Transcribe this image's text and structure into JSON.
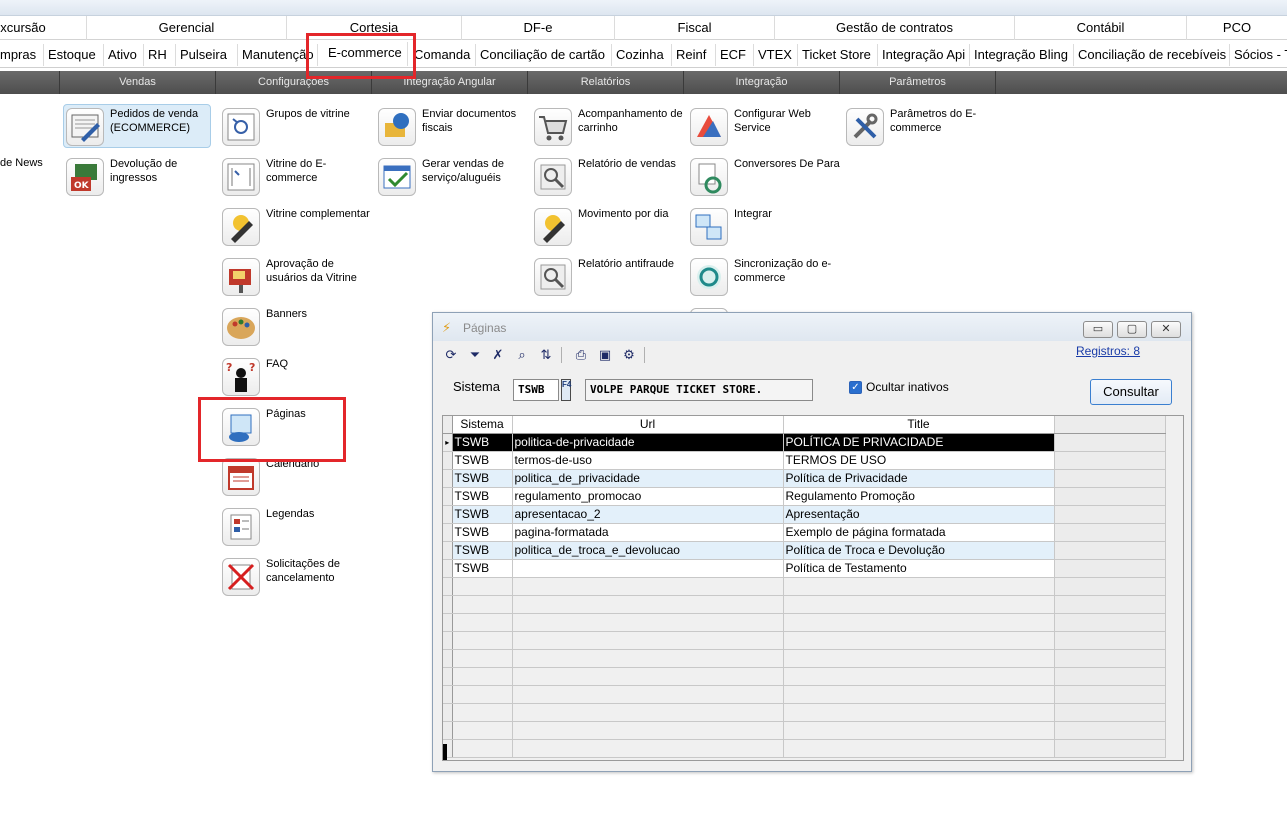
{
  "menu_top": [
    "xcursão",
    "Gerencial",
    "Cortesia",
    "DF-e",
    "Fiscal",
    "Gestão de contratos",
    "Contábil",
    "PCO"
  ],
  "menu_tabs": [
    "mpras",
    "Estoque",
    "Ativo",
    "RH",
    "Pulseira",
    "Manutenção",
    "E-commerce",
    "Comanda",
    "Conciliação de cartão",
    "Cozinha",
    "Reinf",
    "ECF",
    "VTEX",
    "Ticket Store",
    "Integração Api",
    "Integração Bling",
    "Conciliação de recebíveis",
    "Sócios - T"
  ],
  "active_tab": "E-commerce",
  "sections": [
    "Vendas",
    "Configurações",
    "Integração Angular",
    "Relatórios",
    "Integração",
    "Parâmetros"
  ],
  "col0": {
    "news_label": "de News"
  },
  "col_vendas": [
    {
      "label": "Pedidos de venda (ECOMMERCE)",
      "icon": "sales-order-icon"
    },
    {
      "label": "Devolução de ingressos",
      "icon": "ticket-return-icon"
    }
  ],
  "col_config": [
    {
      "label": "Grupos de vitrine",
      "icon": "showcase-group-icon"
    },
    {
      "label": "Vitrine do E-commerce",
      "icon": "showcase-icon"
    },
    {
      "label": "Vitrine complementar",
      "icon": "complementary-showcase-icon"
    },
    {
      "label": "Aprovação de usuários da Vitrine",
      "icon": "mailbox-icon"
    },
    {
      "label": "Banners",
      "icon": "palette-icon"
    },
    {
      "label": "FAQ",
      "icon": "question-person-icon"
    },
    {
      "label": "Páginas",
      "icon": "pages-computer-icon"
    },
    {
      "label": "Calendário",
      "icon": "calendar-icon"
    },
    {
      "label": "Legendas",
      "icon": "legend-icon"
    },
    {
      "label": "Solicitações de cancelamento",
      "icon": "cancel-request-icon"
    }
  ],
  "col_angular": [
    {
      "label": "Enviar documentos fiscais",
      "icon": "send-documents-icon"
    },
    {
      "label": "Gerar vendas de serviço/aluguéis",
      "icon": "generate-sales-icon"
    }
  ],
  "col_relatorios": [
    {
      "label": "Acompanhamento de carrinho",
      "icon": "shopping-cart-icon"
    },
    {
      "label": "Relatório de vendas",
      "icon": "sales-report-icon"
    },
    {
      "label": "Movimento por dia",
      "icon": "daily-movement-icon"
    },
    {
      "label": "Relatório antifraude",
      "icon": "antifraud-report-icon"
    }
  ],
  "col_integracao": [
    {
      "label": "Configurar Web Service",
      "icon": "web-service-icon"
    },
    {
      "label": "Conversores De Para",
      "icon": "converter-icon"
    },
    {
      "label": "Integrar",
      "icon": "integrate-icon"
    },
    {
      "label": "Sincronização do e-commerce",
      "icon": "sync-icon"
    }
  ],
  "col_parametros": [
    {
      "label": "Parâmetros do E-commerce",
      "icon": "tools-icon"
    }
  ],
  "dialog": {
    "title": "Páginas",
    "registros": "Registros: 8",
    "sistema_label": "Sistema",
    "sistema_value": "TSWB",
    "f4_label": "F4",
    "sistema_desc": "VOLPE PARQUE TICKET STORE.",
    "ocultar_label": "Ocultar inativos",
    "ocultar_checked": true,
    "consultar_label": "Consultar",
    "columns": [
      "Sistema",
      "Url",
      "Title"
    ],
    "rows": [
      {
        "sistema": "TSWB",
        "url": "politica-de-privacidade",
        "title": "POLÍTICA DE PRIVACIDADE"
      },
      {
        "sistema": "TSWB",
        "url": "termos-de-uso",
        "title": "TERMOS DE USO"
      },
      {
        "sistema": "TSWB",
        "url": "politica_de_privacidade",
        "title": "Política de Privacidade"
      },
      {
        "sistema": "TSWB",
        "url": "regulamento_promocao",
        "title": "Regulamento Promoção"
      },
      {
        "sistema": "TSWB",
        "url": "apresentacao_2",
        "title": "Apresentação"
      },
      {
        "sistema": "TSWB",
        "url": "pagina-formatada",
        "title": "Exemplo de página formatada"
      },
      {
        "sistema": "TSWB",
        "url": "politica_de_troca_e_devolucao",
        "title": "Política de Troca e Devolução"
      },
      {
        "sistema": "TSWB",
        "url": "",
        "title": "Política de Testamento"
      }
    ]
  },
  "colors": {
    "highlight": "#e3262a",
    "subbar": "#5a5a5a",
    "row_blue": "#e3f0fa",
    "selected_row": "#000000"
  }
}
